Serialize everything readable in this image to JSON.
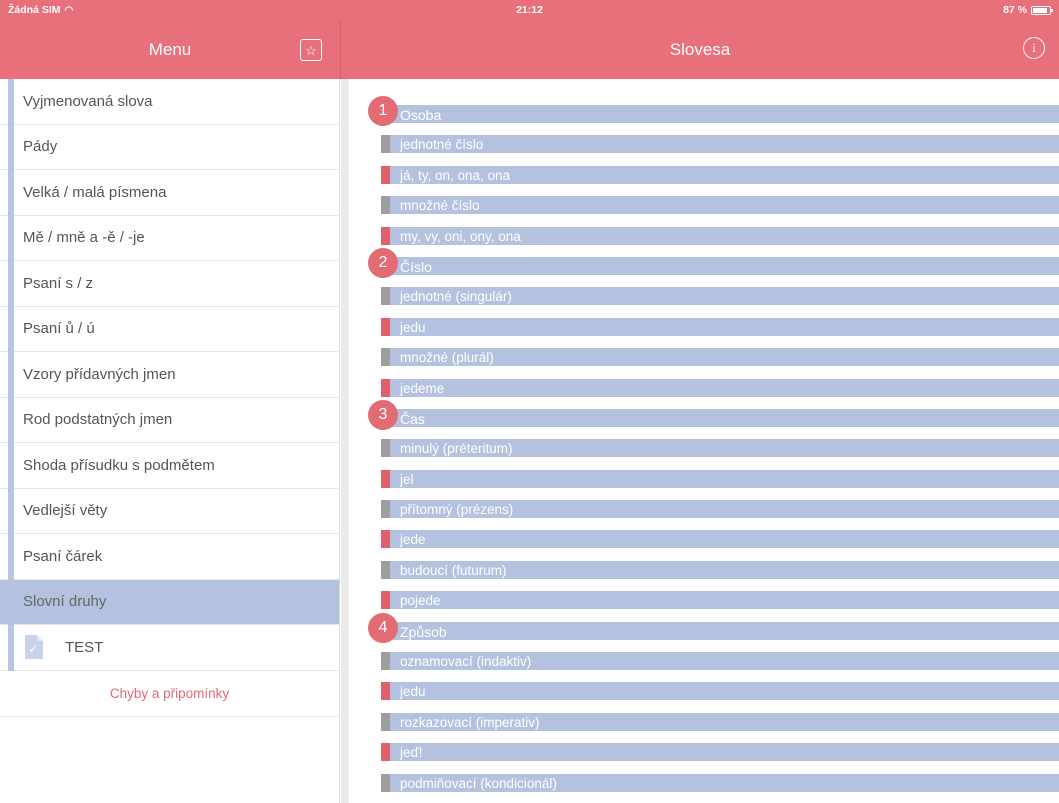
{
  "status_bar": {
    "carrier": "Žádná SIM",
    "time": "21:12",
    "battery": "87 %"
  },
  "left_nav": {
    "title": "Menu"
  },
  "right_nav": {
    "title": "Slovesa"
  },
  "menu": {
    "items": [
      {
        "label": "Vyjmenovaná slova"
      },
      {
        "label": "Pády"
      },
      {
        "label": "Velká / malá písmena"
      },
      {
        "label": "Mě / mně a -ě / -je"
      },
      {
        "label": "Psaní s / z"
      },
      {
        "label": "Psaní ů / ú"
      },
      {
        "label": "Vzory přídavných jmen"
      },
      {
        "label": "Rod podstatných jmen"
      },
      {
        "label": "Shoda přísudku s podmětem"
      },
      {
        "label": "Vedlejší věty"
      },
      {
        "label": "Psaní čárek"
      },
      {
        "label": "Slovní druhy"
      }
    ],
    "test_label": "TEST",
    "feedback_label": "Chyby a připomínky"
  },
  "content": {
    "sections": [
      {
        "num": "1",
        "title": "Osoba",
        "rows": [
          "jednotné číslo",
          "já, ty, on, ona, ona",
          "množné číslo",
          "my, vy, oni, ony, ona"
        ]
      },
      {
        "num": "2",
        "title": "Číslo",
        "rows": [
          "jednotné (singulár)",
          "jedu",
          "množné (plurál)",
          "jedeme"
        ]
      },
      {
        "num": "3",
        "title": "Čas",
        "rows": [
          "minulý (préteritum)",
          "jel",
          "přítomný (prézens)",
          "jede",
          "budoucí (futurum)",
          "pojede"
        ]
      },
      {
        "num": "4",
        "title": "Způsob",
        "rows": [
          "oznamovací (indaktiv)",
          "jedu",
          "rozkazovací (imperativ)",
          "jeď!",
          "podmiňovací (kondicionál)"
        ]
      }
    ]
  },
  "colors": {
    "header": "#e8707a",
    "bar": "#b4c2df",
    "marker_heading": "#9e9e9e",
    "marker_example": "#e0606c"
  }
}
